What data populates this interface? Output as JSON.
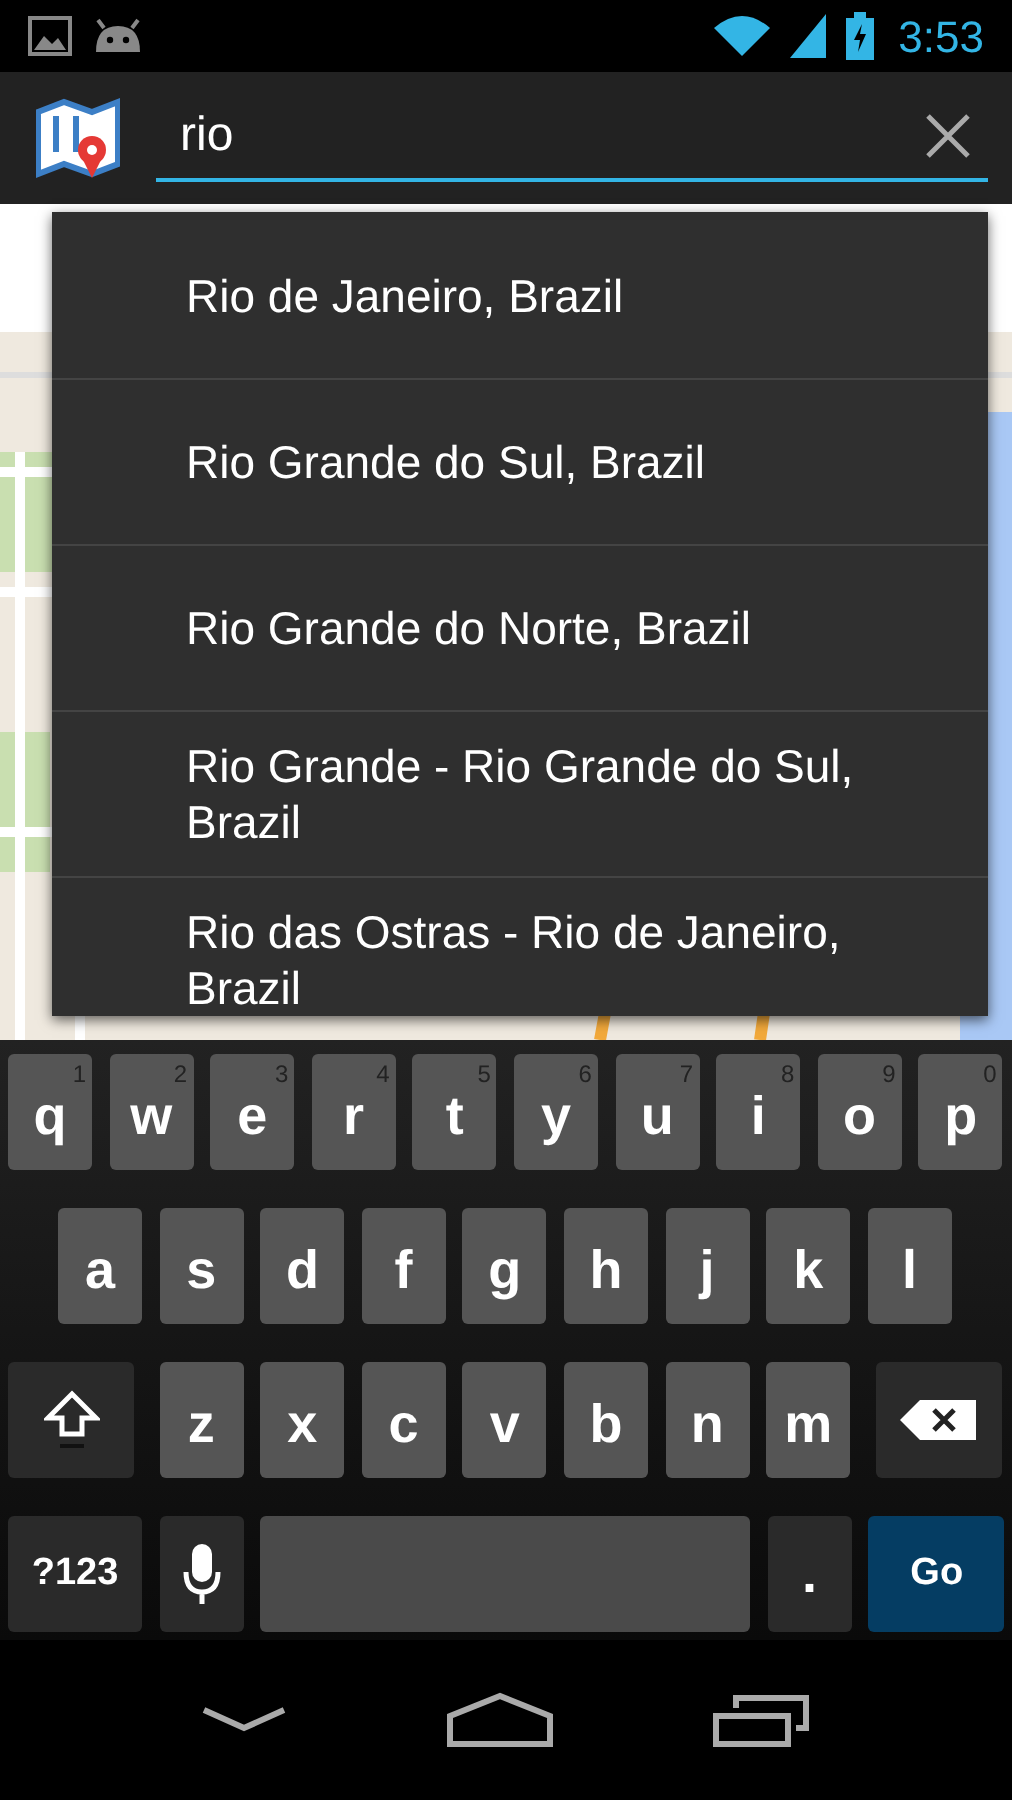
{
  "status_bar": {
    "time": "3:53"
  },
  "search": {
    "value": "rio"
  },
  "suggestions": [
    "Rio de Janeiro, Brazil",
    "Rio Grande do Sul, Brazil",
    "Rio Grande do Norte, Brazil",
    "Rio Grande - Rio Grande do Sul, Brazil",
    "Rio das Ostras - Rio de Janeiro, Brazil"
  ],
  "keyboard": {
    "top_row": [
      {
        "kind": "letter",
        "label": "q",
        "hint": "1"
      },
      {
        "kind": "letter",
        "label": "w",
        "hint": "2"
      },
      {
        "kind": "letter",
        "label": "e",
        "hint": "3"
      },
      {
        "kind": "letter",
        "label": "r",
        "hint": "4"
      },
      {
        "kind": "letter",
        "label": "t",
        "hint": "5"
      },
      {
        "kind": "letter",
        "label": "y",
        "hint": "6"
      },
      {
        "kind": "letter",
        "label": "u",
        "hint": "7"
      },
      {
        "kind": "letter",
        "label": "i",
        "hint": "8"
      },
      {
        "kind": "letter",
        "label": "o",
        "hint": "9"
      },
      {
        "kind": "letter",
        "label": "p",
        "hint": "0"
      }
    ],
    "home_row": [
      {
        "kind": "letter",
        "label": "a"
      },
      {
        "kind": "letter",
        "label": "s"
      },
      {
        "kind": "letter",
        "label": "d"
      },
      {
        "kind": "letter",
        "label": "f"
      },
      {
        "kind": "letter",
        "label": "g"
      },
      {
        "kind": "letter",
        "label": "h"
      },
      {
        "kind": "letter",
        "label": "j"
      },
      {
        "kind": "letter",
        "label": "k"
      },
      {
        "kind": "letter",
        "label": "l"
      }
    ],
    "bottom_row": [
      {
        "kind": "shift"
      },
      {
        "kind": "letter",
        "label": "z"
      },
      {
        "kind": "letter",
        "label": "x"
      },
      {
        "kind": "letter",
        "label": "c"
      },
      {
        "kind": "letter",
        "label": "v"
      },
      {
        "kind": "letter",
        "label": "b"
      },
      {
        "kind": "letter",
        "label": "n"
      },
      {
        "kind": "letter",
        "label": "m"
      },
      {
        "kind": "delete"
      }
    ],
    "function_row": [
      {
        "kind": "symbols",
        "label": "?123"
      },
      {
        "kind": "mic"
      },
      {
        "kind": "space"
      },
      {
        "kind": "period",
        "label": "."
      },
      {
        "kind": "action",
        "label": "Go"
      }
    ]
  }
}
